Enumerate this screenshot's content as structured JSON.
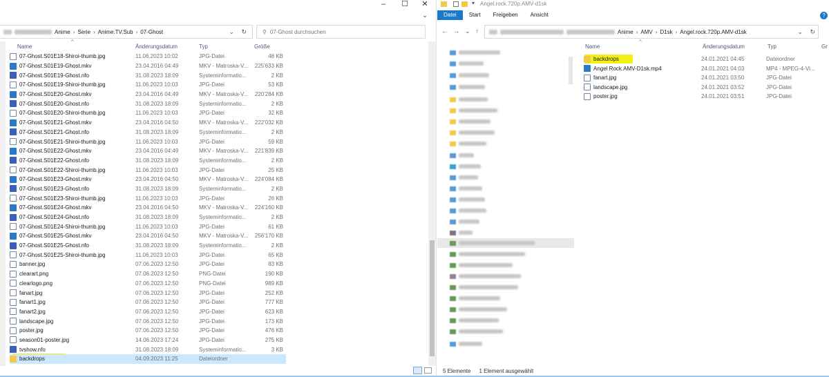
{
  "left": {
    "minimize": "–",
    "maximize": "☐",
    "close": "✕",
    "expand": "⌄",
    "breadcrumb": [
      "Anime",
      "Serie",
      "Anime.TV.Sub",
      "07-Ghost"
    ],
    "search_placeholder": "07-Ghost durchsuchen",
    "columns": {
      "name": "Name",
      "date": "Änderungsdatum",
      "type": "Typ",
      "size": "Größe"
    },
    "files": [
      {
        "icon": "file",
        "name": "07-Ghost.S01E18-Shiroi-thumb.jpg",
        "date": "11.06.2023 10:02",
        "type": "JPG-Datei",
        "size": "48 KB"
      },
      {
        "icon": "mkv",
        "name": "07-Ghost.S01E19-Ghost.mkv",
        "date": "23.04.2016 04:49",
        "type": "MKV - Matroska-V...",
        "size": "225'633 KB"
      },
      {
        "icon": "nfo",
        "name": "07-Ghost.S01E19-Ghost.nfo",
        "date": "31.08.2023 18:09",
        "type": "Systeminformatio...",
        "size": "2 KB"
      },
      {
        "icon": "file",
        "name": "07-Ghost.S01E19-Shiroi-thumb.jpg",
        "date": "11.06.2023 10:03",
        "type": "JPG-Datei",
        "size": "53 KB"
      },
      {
        "icon": "mkv",
        "name": "07-Ghost.S01E20-Ghost.mkv",
        "date": "23.04.2016 04:49",
        "type": "MKV - Matroska-V...",
        "size": "220'284 KB"
      },
      {
        "icon": "nfo",
        "name": "07-Ghost.S01E20-Ghost.nfo",
        "date": "31.08.2023 18:09",
        "type": "Systeminformatio...",
        "size": "2 KB"
      },
      {
        "icon": "file",
        "name": "07-Ghost.S01E20-Shiroi-thumb.jpg",
        "date": "11.06.2023 10:03",
        "type": "JPG-Datei",
        "size": "32 KB"
      },
      {
        "icon": "mkv",
        "name": "07-Ghost.S01E21-Ghost.mkv",
        "date": "23.04.2016 04:50",
        "type": "MKV - Matroska-V...",
        "size": "222'032 KB"
      },
      {
        "icon": "nfo",
        "name": "07-Ghost.S01E21-Ghost.nfo",
        "date": "31.08.2023 18:09",
        "type": "Systeminformatio...",
        "size": "2 KB"
      },
      {
        "icon": "file",
        "name": "07-Ghost.S01E21-Shiroi-thumb.jpg",
        "date": "11.06.2023 10:03",
        "type": "JPG-Datei",
        "size": "59 KB"
      },
      {
        "icon": "mkv",
        "name": "07-Ghost.S01E22-Ghost.mkv",
        "date": "23.04.2016 04:49",
        "type": "MKV - Matroska-V...",
        "size": "221'839 KB"
      },
      {
        "icon": "nfo",
        "name": "07-Ghost.S01E22-Ghost.nfo",
        "date": "31.08.2023 18:09",
        "type": "Systeminformatio...",
        "size": "2 KB"
      },
      {
        "icon": "file",
        "name": "07-Ghost.S01E22-Shiroi-thumb.jpg",
        "date": "11.06.2023 10:03",
        "type": "JPG-Datei",
        "size": "25 KB"
      },
      {
        "icon": "mkv",
        "name": "07-Ghost.S01E23-Ghost.mkv",
        "date": "23.04.2016 04:50",
        "type": "MKV - Matroska-V...",
        "size": "224'084 KB"
      },
      {
        "icon": "nfo",
        "name": "07-Ghost.S01E23-Ghost.nfo",
        "date": "31.08.2023 18:09",
        "type": "Systeminformatio...",
        "size": "2 KB"
      },
      {
        "icon": "file",
        "name": "07-Ghost.S01E23-Shiroi-thumb.jpg",
        "date": "11.06.2023 10:03",
        "type": "JPG-Datei",
        "size": "26 KB"
      },
      {
        "icon": "mkv",
        "name": "07-Ghost.S01E24-Ghost.mkv",
        "date": "23.04.2016 04:50",
        "type": "MKV - Matroska-V...",
        "size": "224'160 KB"
      },
      {
        "icon": "nfo",
        "name": "07-Ghost.S01E24-Ghost.nfo",
        "date": "31.08.2023 18:09",
        "type": "Systeminformatio...",
        "size": "2 KB"
      },
      {
        "icon": "file",
        "name": "07-Ghost.S01E24-Shiroi-thumb.jpg",
        "date": "11.06.2023 10:03",
        "type": "JPG-Datei",
        "size": "61 KB"
      },
      {
        "icon": "mkv",
        "name": "07-Ghost.S01E25-Ghost.mkv",
        "date": "23.04.2016 04:50",
        "type": "MKV - Matroska-V...",
        "size": "256'170 KB"
      },
      {
        "icon": "nfo",
        "name": "07-Ghost.S01E25-Ghost.nfo",
        "date": "31.08.2023 18:09",
        "type": "Systeminformatio...",
        "size": "2 KB"
      },
      {
        "icon": "file",
        "name": "07-Ghost.S01E25-Shiroi-thumb.jpg",
        "date": "11.06.2023 10:03",
        "type": "JPG-Datei",
        "size": "65 KB"
      },
      {
        "icon": "file",
        "name": "banner.jpg",
        "date": "07.06.2023 12:50",
        "type": "JPG-Datei",
        "size": "83 KB"
      },
      {
        "icon": "file",
        "name": "clearart.png",
        "date": "07.06.2023 12:50",
        "type": "PNG-Datei",
        "size": "190 KB"
      },
      {
        "icon": "file",
        "name": "clearlogo.png",
        "date": "07.06.2023 12:50",
        "type": "PNG-Datei",
        "size": "989 KB"
      },
      {
        "icon": "file",
        "name": "fanart.jpg",
        "date": "07.06.2023 12:50",
        "type": "JPG-Datei",
        "size": "252 KB"
      },
      {
        "icon": "file",
        "name": "fanart1.jpg",
        "date": "07.06.2023 12:50",
        "type": "JPG-Datei",
        "size": "777 KB"
      },
      {
        "icon": "file",
        "name": "fanart2.jpg",
        "date": "07.06.2023 12:50",
        "type": "JPG-Datei",
        "size": "623 KB"
      },
      {
        "icon": "file",
        "name": "landscape.jpg",
        "date": "07.06.2023 12:50",
        "type": "JPG-Datei",
        "size": "173 KB"
      },
      {
        "icon": "file",
        "name": "poster.jpg",
        "date": "07.06.2023 12:50",
        "type": "JPG-Datei",
        "size": "476 KB"
      },
      {
        "icon": "file",
        "name": "season01-poster.jpg",
        "date": "14.06.2023 17:24",
        "type": "JPG-Datei",
        "size": "275 KB"
      },
      {
        "icon": "nfo",
        "name": "tvshow.nfo",
        "date": "31.08.2023 18:09",
        "type": "Systeminformatio...",
        "size": "3 KB"
      },
      {
        "icon": "folder",
        "name": "backdrops",
        "date": "04.09.2023 11:25",
        "type": "Dateiordner",
        "size": "",
        "selected": true
      }
    ]
  },
  "right": {
    "title": "Angel.rock.720p.AMV-d1sk",
    "ribbon_tabs": [
      "Datei",
      "Start",
      "Freigeben",
      "Ansicht"
    ],
    "breadcrumb": [
      "Anime",
      "AMV",
      "D1sk",
      "Angel.rock.720p.AMV-d1sk"
    ],
    "columns": {
      "name": "Name",
      "date": "Änderungsdatum",
      "type": "Typ",
      "size": "Gr"
    },
    "files": [
      {
        "icon": "folder",
        "name": "backdrops",
        "date": "24.01.2021 04:45",
        "type": "Dateiordner",
        "selected": true
      },
      {
        "icon": "mkv",
        "name": "Angel Rock.AMV-D1sk.mp4",
        "date": "24.01.2021 04:03",
        "type": "MP4 - MPEG-4-Vi..."
      },
      {
        "icon": "file",
        "name": "fanart.jpg",
        "date": "24.01.2021 03:50",
        "type": "JPG-Datei"
      },
      {
        "icon": "file",
        "name": "landscape.jpg",
        "date": "24.01.2021 03:52",
        "type": "JPG-Datei"
      },
      {
        "icon": "file",
        "name": "poster.jpg",
        "date": "24.01.2021 03:51",
        "type": "JPG-Datei"
      }
    ],
    "status": {
      "count": "5 Elemente",
      "selected": "1 Element ausgewählt"
    }
  },
  "colors": {
    "highlight": "#f2f014",
    "selection": "#cce8ff",
    "accent": "#1979ca"
  }
}
